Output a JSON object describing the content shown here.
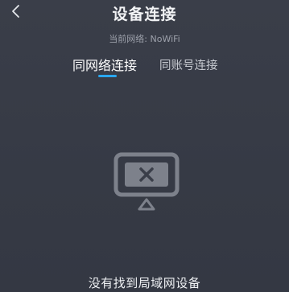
{
  "header": {
    "title": "设备连接",
    "back_icon": "chevron-left-icon"
  },
  "status": {
    "network_text": "当前网络: NoWiFi"
  },
  "tabs": [
    {
      "label": "同网络连接",
      "active": true
    },
    {
      "label": "同账号连接",
      "active": false
    }
  ],
  "empty_state": {
    "icon": "tv-disconnected-icon",
    "message": "没有找到局域网设备"
  },
  "colors": {
    "background": "#373b46",
    "accent": "#2aa7f0",
    "muted_text": "#9da1ab"
  }
}
